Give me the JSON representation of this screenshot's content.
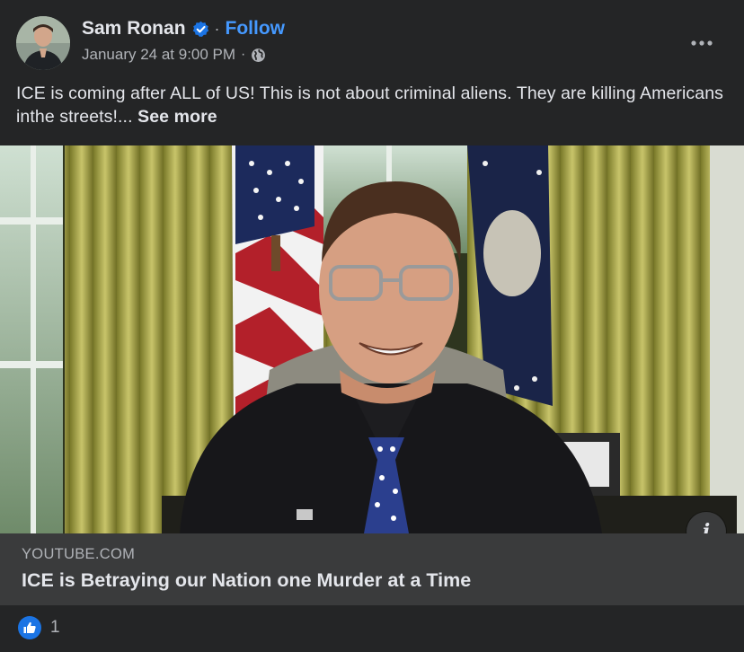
{
  "post": {
    "author": "Sam Ronan",
    "separator": "·",
    "follow_label": "Follow",
    "timestamp": "January 24 at 9:00 PM",
    "audience_icon": "globe-icon",
    "text": "ICE is coming after ALL of US! This is not about criminal aliens. They are killing Americans inthe streets!...",
    "see_more_label": "See more"
  },
  "link_preview": {
    "domain": "YOUTUBE.COM",
    "title": "ICE is Betraying our Nation one Murder at a Time",
    "info_icon": "i"
  },
  "reactions": {
    "icon": "like-icon",
    "count": "1"
  },
  "colors": {
    "background": "#242526",
    "link_box": "#3a3b3c",
    "follow": "#4599ff",
    "like": "#1b74e4",
    "text_primary": "#e4e6eb",
    "text_secondary": "#b0b3b8"
  }
}
